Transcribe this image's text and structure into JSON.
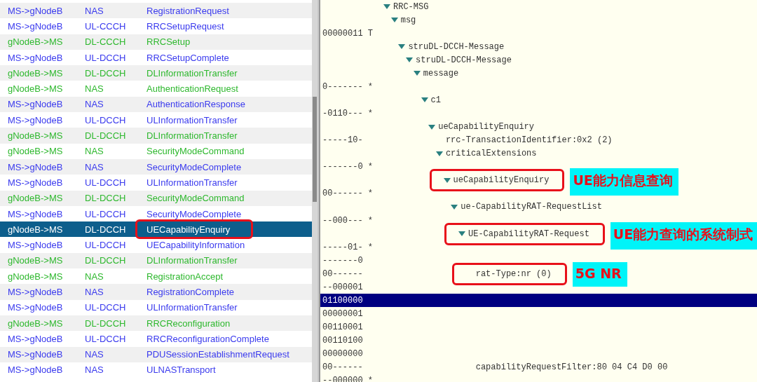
{
  "message_list": {
    "rows": [
      {
        "direction": "MS->gNodeB",
        "channel": "NAS",
        "message": "RegistrationRequest",
        "color": "#3a3aee",
        "selected": false,
        "highlighted": false
      },
      {
        "direction": "MS->gNodeB",
        "channel": "UL-CCCH",
        "message": "RRCSetupRequest",
        "color": "#3a3aee",
        "selected": false,
        "highlighted": false
      },
      {
        "direction": "gNodeB->MS",
        "channel": "DL-CCCH",
        "message": "RRCSetup",
        "color": "#2eb82e",
        "selected": false,
        "highlighted": false
      },
      {
        "direction": "MS->gNodeB",
        "channel": "UL-DCCH",
        "message": "RRCSetupComplete",
        "color": "#3a3aee",
        "selected": false,
        "highlighted": false
      },
      {
        "direction": "gNodeB->MS",
        "channel": "DL-DCCH",
        "message": "DLInformationTransfer",
        "color": "#2eb82e",
        "selected": false,
        "highlighted": false
      },
      {
        "direction": "gNodeB->MS",
        "channel": "NAS",
        "message": "AuthenticationRequest",
        "color": "#2eb82e",
        "selected": false,
        "highlighted": false
      },
      {
        "direction": "MS->gNodeB",
        "channel": "NAS",
        "message": "AuthenticationResponse",
        "color": "#3a3aee",
        "selected": false,
        "highlighted": false
      },
      {
        "direction": "MS->gNodeB",
        "channel": "UL-DCCH",
        "message": "ULInformationTransfer",
        "color": "#3a3aee",
        "selected": false,
        "highlighted": false
      },
      {
        "direction": "gNodeB->MS",
        "channel": "DL-DCCH",
        "message": "DLInformationTransfer",
        "color": "#2eb82e",
        "selected": false,
        "highlighted": false
      },
      {
        "direction": "gNodeB->MS",
        "channel": "NAS",
        "message": "SecurityModeCommand",
        "color": "#2eb82e",
        "selected": false,
        "highlighted": false
      },
      {
        "direction": "MS->gNodeB",
        "channel": "NAS",
        "message": "SecurityModeComplete",
        "color": "#3a3aee",
        "selected": false,
        "highlighted": false
      },
      {
        "direction": "MS->gNodeB",
        "channel": "UL-DCCH",
        "message": "ULInformationTransfer",
        "color": "#3a3aee",
        "selected": false,
        "highlighted": false
      },
      {
        "direction": "gNodeB->MS",
        "channel": "DL-DCCH",
        "message": "SecurityModeCommand",
        "color": "#2eb82e",
        "selected": false,
        "highlighted": false
      },
      {
        "direction": "MS->gNodeB",
        "channel": "UL-DCCH",
        "message": "SecurityModeComplete",
        "color": "#3a3aee",
        "selected": false,
        "highlighted": false
      },
      {
        "direction": "gNodeB->MS",
        "channel": "DL-DCCH",
        "message": "UECapabilityEnquiry",
        "selected": true,
        "highlighted": true
      },
      {
        "direction": "MS->gNodeB",
        "channel": "UL-DCCH",
        "message": "UECapabilityInformation",
        "color": "#3a3aee",
        "selected": false,
        "highlighted": false
      },
      {
        "direction": "gNodeB->MS",
        "channel": "DL-DCCH",
        "message": "DLInformationTransfer",
        "color": "#2eb82e",
        "selected": false,
        "highlighted": false
      },
      {
        "direction": "gNodeB->MS",
        "channel": "NAS",
        "message": "RegistrationAccept",
        "color": "#2eb82e",
        "selected": false,
        "highlighted": false
      },
      {
        "direction": "MS->gNodeB",
        "channel": "NAS",
        "message": "RegistrationComplete",
        "color": "#3a3aee",
        "selected": false,
        "highlighted": false
      },
      {
        "direction": "MS->gNodeB",
        "channel": "UL-DCCH",
        "message": "ULInformationTransfer",
        "color": "#3a3aee",
        "selected": false,
        "highlighted": false
      },
      {
        "direction": "gNodeB->MS",
        "channel": "DL-DCCH",
        "message": "RRCReconfiguration",
        "color": "#2eb82e",
        "selected": false,
        "highlighted": false
      },
      {
        "direction": "MS->gNodeB",
        "channel": "UL-DCCH",
        "message": "RRCReconfigurationComplete",
        "color": "#3a3aee",
        "selected": false,
        "highlighted": false
      },
      {
        "direction": "MS->gNodeB",
        "channel": "NAS",
        "message": "PDUSessionEstablishmentRequest",
        "color": "#3a3aee",
        "selected": false,
        "highlighted": false
      },
      {
        "direction": "MS->gNodeB",
        "channel": "NAS",
        "message": "ULNASTransport",
        "color": "#3a3aee",
        "selected": false,
        "highlighted": false
      }
    ]
  },
  "decode_tree": {
    "nodes": [
      {
        "label": "RRC-MSG",
        "expanded": true,
        "children": [
          {
            "label": "msg",
            "expanded": true,
            "children": [
              {
                "label": "struDL-DCCH-Message",
                "before": [
                  {
                    "text": "00000011 T",
                    "selected": false
                  }
                ],
                "expanded": true,
                "children": [
                  {
                    "label": "struDL-DCCH-Message",
                    "expanded": true,
                    "children": [
                      {
                        "label": "message",
                        "expanded": true,
                        "children": [
                          {
                            "label": "c1",
                            "before": [
                              {
                                "text": "0------- *",
                                "selected": false
                              }
                            ],
                            "expanded": true,
                            "children": [
                              {
                                "label": "ueCapabilityEnquiry",
                                "before": [
                                  {
                                    "text": "-0110--- *",
                                    "selected": false
                                  }
                                ],
                                "expanded": true,
                                "children": [
                                  {
                                    "label": "rrc-TransactionIdentifier:0x2 (2)",
                                    "bits": "-----10-"
                                  },
                                  {
                                    "label": "criticalExtensions",
                                    "expanded": true,
                                    "children": [
                                      {
                                        "label": "ueCapabilityEnquiry",
                                        "before": [
                                          {
                                            "text": "-------0 *",
                                            "selected": false
                                          }
                                        ],
                                        "expanded": true,
                                        "highlighted": true,
                                        "callout": "UE能力信息查询",
                                        "children": [
                                          {
                                            "label": "ue-CapabilityRAT-RequestList",
                                            "before": [
                                              {
                                                "text": "00------ *",
                                                "selected": false
                                              }
                                            ],
                                            "expanded": true,
                                            "children": [
                                              {
                                                "label": "UE-CapabilityRAT-Request",
                                                "before": [
                                                  {
                                                    "text": "--000--- *",
                                                    "selected": false
                                                  }
                                                ],
                                                "expanded": true,
                                                "highlighted": true,
                                                "callout": "UE能力查询的系统制式",
                                                "children": [
                                                  {
                                                    "label": "rat-Type:nr (0)",
                                                    "before": [
                                                      {
                                                        "text": "-----01- *",
                                                        "selected": false
                                                      },
                                                      {
                                                        "text": "-------0",
                                                        "selected": false
                                                      }
                                                    ],
                                                    "bits": "00------",
                                                    "highlighted": true,
                                                    "callout": "5G NR"
                                                  },
                                                  {
                                                    "label": "capabilityRequestFilter:80 04 C4 D0 00",
                                                    "before": [
                                                      {
                                                        "text": "--000001",
                                                        "selected": false
                                                      },
                                                      {
                                                        "text": "01100000",
                                                        "selected": true
                                                      },
                                                      {
                                                        "text": "00000001",
                                                        "selected": false
                                                      },
                                                      {
                                                        "text": "00110001",
                                                        "selected": false
                                                      },
                                                      {
                                                        "text": "00110100",
                                                        "selected": false
                                                      },
                                                      {
                                                        "text": "00000000",
                                                        "selected": false
                                                      }
                                                    ],
                                                    "bits": "00------"
                                                  }
                                                ]
                                              }
                                            ]
                                          }
                                        ]
                                      }
                                    ]
                                  }
                                ]
                              }
                            ]
                          }
                        ]
                      }
                    ]
                  }
                ]
              }
            ]
          }
        ]
      }
    ],
    "trailing_lines": [
      {
        "text": "--000000 *",
        "selected": false
      }
    ]
  }
}
